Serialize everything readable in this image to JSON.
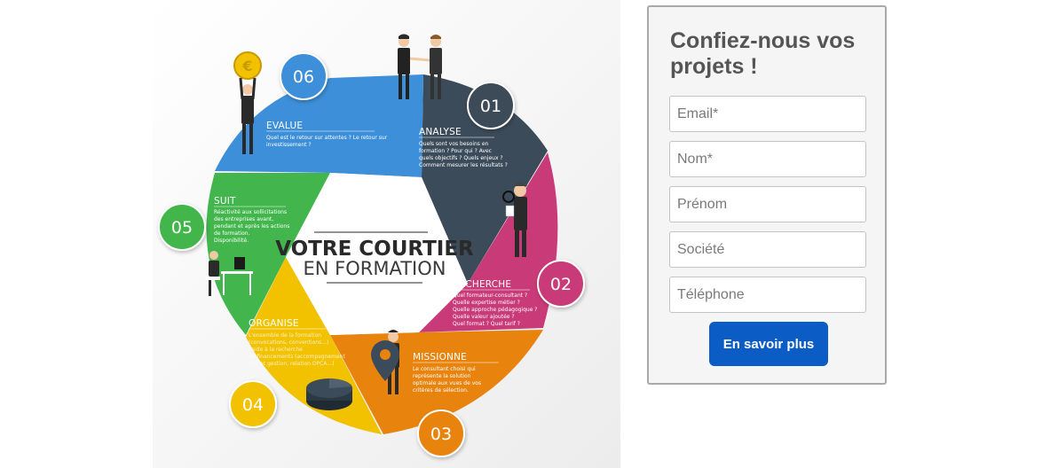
{
  "infographic": {
    "center_line1": "VOTRE COURTIER",
    "center_line2": "EN FORMATION",
    "segments": [
      {
        "number": "01",
        "title": "ANALYSE",
        "color": "#3c4b59",
        "desc": [
          "Quels sont vos besoins en",
          "formation ? Pour qui ? Avec",
          "quels objectifs ? Quels enjeux ?",
          "Comment mesurer les résultats ?"
        ]
      },
      {
        "number": "02",
        "title": "RECHERCHE",
        "color": "#c93a78",
        "desc": [
          "Quel formateur-consultant ?",
          "Quelle expertise métier ?",
          "Quelle approche pédagogique ?",
          "Quelle valeur ajoutée ?",
          "Quel format ? Quel tarif ?"
        ]
      },
      {
        "number": "03",
        "title": "MISSIONNE",
        "color": "#e8840e",
        "desc": [
          "Le consultant choisi qui",
          "représente la solution",
          "optimale aux vues de vos",
          "critères de sélection."
        ]
      },
      {
        "number": "04",
        "title": "ORGANISE",
        "color": "#f2c200",
        "desc": [
          "L'ensemble de la formation",
          "(convocations, conventions...)",
          "l'aide à la recherche",
          "de financements (accompagnement",
          "CPF et gestion, relation OPCA...)"
        ]
      },
      {
        "number": "05",
        "title": "SUIT",
        "color": "#42b64c",
        "desc": [
          "Réactivité aux sollicitations",
          "des entreprises avant,",
          "pendant et après les actions",
          "de formation.",
          "Disponibilité."
        ]
      },
      {
        "number": "06",
        "title": "EVALUE",
        "color": "#3d8fd9",
        "desc": [
          "Quel est le retour sur attentes ? Le retour sur",
          "investissement ?"
        ]
      }
    ],
    "icons": [
      "handshake-people-icon",
      "detective-magnifier-icon",
      "businessman-map-pin-icon",
      "pie-chart-3d-icon",
      "person-at-desk-icon",
      "businessman-euro-coin-icon"
    ],
    "coin_symbol": "€"
  },
  "form": {
    "title": "Confiez-nous vos projets !",
    "fields": [
      {
        "placeholder": "Email*",
        "value": ""
      },
      {
        "placeholder": "Nom*",
        "value": ""
      },
      {
        "placeholder": "Prénom",
        "value": ""
      },
      {
        "placeholder": "Société",
        "value": ""
      },
      {
        "placeholder": "Téléphone",
        "value": ""
      }
    ],
    "submit_label": "En savoir plus",
    "accent_color": "#0b5cc4"
  }
}
